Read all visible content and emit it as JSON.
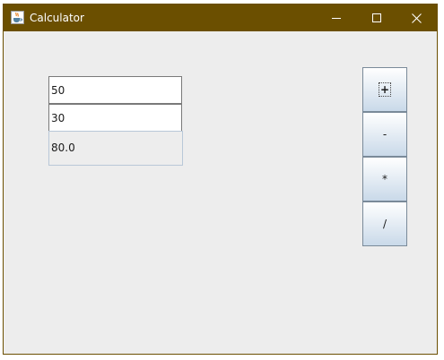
{
  "window": {
    "title": "Calculator",
    "app_icon": "java-coffee-cup-icon",
    "controls": [
      "minimize-icon",
      "maximize-icon",
      "close-icon"
    ],
    "titlebar_color": "#6b4f00"
  },
  "inputs": {
    "first_operand": "50",
    "second_operand": "30"
  },
  "result": {
    "value": "80.0"
  },
  "operators": {
    "add": "+",
    "subtract": "-",
    "multiply": "*",
    "divide": "/"
  }
}
